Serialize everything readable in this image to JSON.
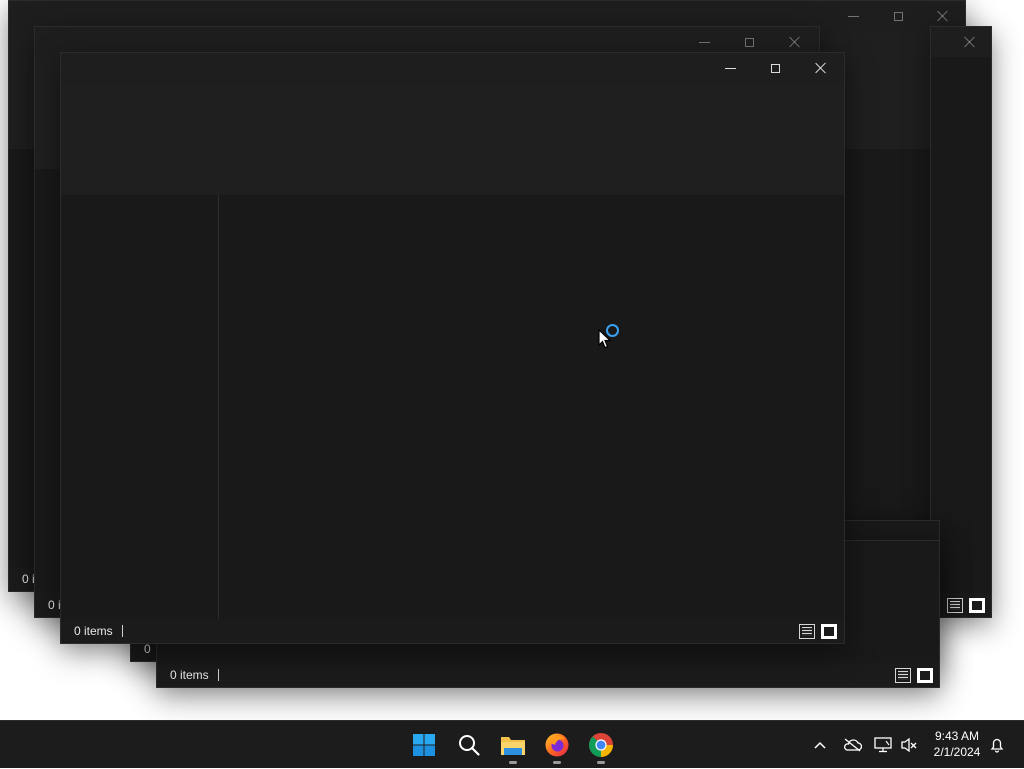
{
  "windows": {
    "back": {
      "status_text": "0 i"
    },
    "second": {
      "status_text": "0 i"
    },
    "bottom": {
      "status_text": "0 items"
    },
    "behind_bottom": {
      "status_text": "0 "
    },
    "front": {
      "status_text": "0 items"
    }
  },
  "captions": {
    "minimize": "Minimize",
    "maximize": "Maximize",
    "close": "Close"
  },
  "view_buttons": {
    "details": "Details view",
    "tiles": "Large icons view"
  },
  "taskbar": {
    "apps": [
      {
        "name": "Start",
        "icon": "windows-logo-icon"
      },
      {
        "name": "Search",
        "icon": "search-icon"
      },
      {
        "name": "File Explorer",
        "icon": "folder-icon",
        "running": true
      },
      {
        "name": "Firefox",
        "icon": "firefox-icon",
        "running": true
      },
      {
        "name": "Chrome",
        "icon": "chrome-icon",
        "running": true
      }
    ],
    "tray_icons": [
      "chevron-up-icon",
      "onedrive-offline-icon",
      "network-icon",
      "volume-muted-icon",
      "notification-bell-icon"
    ],
    "clock": {
      "time": "9:43 AM",
      "date": "2/1/2024"
    }
  },
  "colors": {
    "window_bg": "#191919",
    "taskbar_bg": "#1c1c1c",
    "accent": "#3aa0f0",
    "desktop": "#ffffff"
  }
}
